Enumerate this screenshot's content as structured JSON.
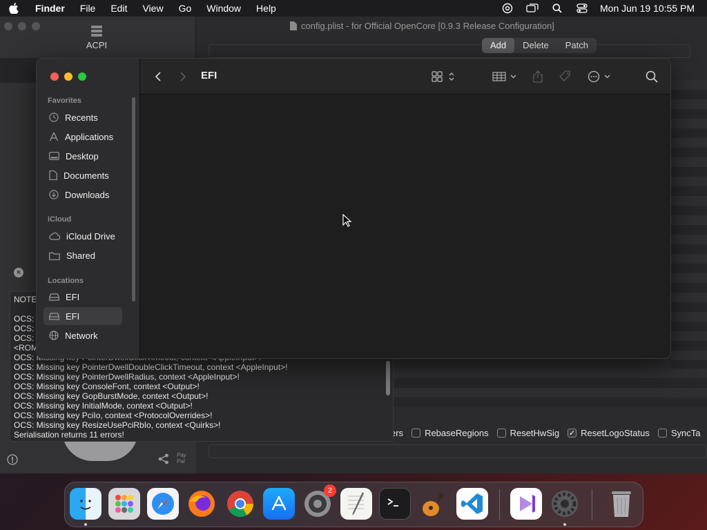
{
  "menubar": {
    "app_name": "Finder",
    "items": [
      "File",
      "Edit",
      "View",
      "Go",
      "Window",
      "Help"
    ],
    "clock": "Mon Jun 19  10:55 PM"
  },
  "ocat": {
    "acpi_label": "ACPI",
    "title": "config.plist - for Official OpenCore [0.9.3 Release Configuration]",
    "segments": [
      "Add",
      "Delete",
      "Patch"
    ],
    "checkboxes": [
      {
        "label": "ers",
        "checked": null
      },
      {
        "label": "RebaseRegions",
        "checked": false
      },
      {
        "label": "ResetHwSig",
        "checked": false
      },
      {
        "label": "ResetLogoStatus",
        "checked": true
      },
      {
        "label": "SyncTa",
        "checked": false
      }
    ],
    "log_lines": [
      "NOTE",
      "OCS:",
      "OCS:",
      "OCS:",
      "<ROM",
      "OCS: Missing key PointerDwellClickTimeout, context <AppleInput>!",
      "OCS: Missing key PointerDwellDoubleClickTimeout, context <AppleInput>!",
      "OCS: Missing key PointerDwellRadius, context <AppleInput>!",
      "OCS: Missing key ConsoleFont, context <Output>!",
      "OCS: Missing key GopBurstMode, context <Output>!",
      "OCS: Missing key InitialMode, context <Output>!",
      "OCS: Missing key PciIo, context <ProtocolOverrides>!",
      "OCS: Missing key ResizeUsePciRbIo, context <Quirks>!",
      "Serialisation returns 11 errors!"
    ],
    "paypal_label": "Pay Pal"
  },
  "finder": {
    "title": "EFI",
    "sidebar": {
      "favorites_header": "Favorites",
      "favorites": [
        "Recents",
        "Applications",
        "Desktop",
        "Documents",
        "Downloads"
      ],
      "icloud_header": "iCloud",
      "icloud": [
        "iCloud Drive",
        "Shared"
      ],
      "locations_header": "Locations",
      "locations": [
        "EFI",
        "EFI",
        "Network"
      ]
    }
  },
  "dock": {
    "apps": [
      "Finder",
      "Launchpad",
      "Safari",
      "Firefox",
      "Chrome",
      "App Store",
      "System Preferences",
      "TextEdit",
      "Terminal",
      "GarageBand",
      "Visual Studio Code",
      "Visual Studio",
      "System Settings",
      "Trash"
    ],
    "badge": "2"
  },
  "colors": {
    "close": "#ff5f57",
    "minimize": "#febc2e",
    "maximize": "#28c840",
    "selection": "#3d3d40"
  }
}
